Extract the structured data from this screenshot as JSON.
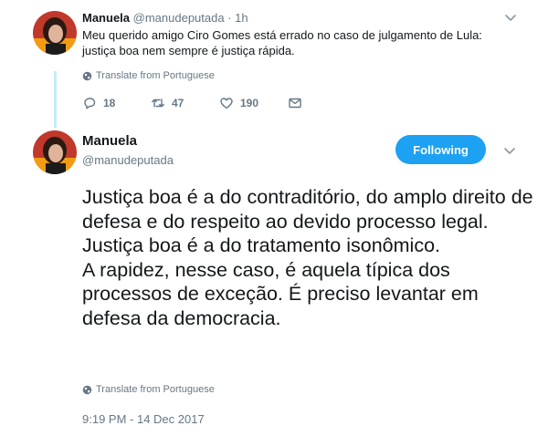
{
  "parent_tweet": {
    "display_name": "Manuela",
    "handle": "@manudeputada",
    "separator": "·",
    "time_ago": "1h",
    "text": "Meu querido amigo Ciro Gomes está errado no caso de julgamento de Lula: justiça boa nem sempre é justiça rápida.",
    "translate_label": "Translate from Portuguese",
    "actions": {
      "reply_count": "18",
      "retweet_count": "47",
      "like_count": "190"
    }
  },
  "main_tweet": {
    "display_name": "Manuela",
    "handle": "@manudeputada",
    "follow_button_label": "Following",
    "text_paragraphs": [
      "Justiça boa é a do contraditório, do amplo direito de defesa e do respeito ao devido processo legal. Justiça boa é a do tratamento isonômico.",
      "A rapidez, nesse caso, é aquela típica dos processos de exceção. É preciso levantar em defesa da democracia."
    ],
    "translate_label": "Translate from Portuguese",
    "timestamp": "9:19 PM - 14 Dec 2017"
  },
  "icons": {
    "reply": "reply-icon",
    "retweet": "retweet-icon",
    "like": "heart-icon",
    "dm": "envelope-icon",
    "menu": "chevron-down-icon",
    "translate": "globe-icon"
  },
  "colors": {
    "accent": "#1da1f2",
    "thread_line": "#c4ecf8",
    "secondary_text": "#657786"
  }
}
